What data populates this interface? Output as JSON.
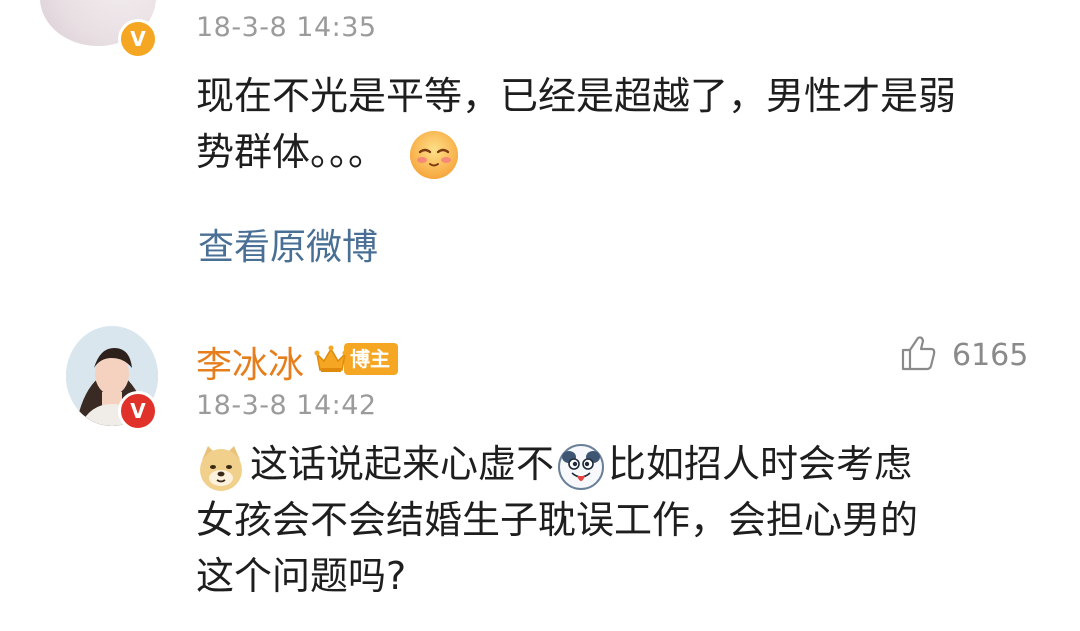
{
  "comments": [
    {
      "timestamp": "18-3-8 14:35",
      "text_part1": "现在不光是平等，已经是超越了，男性才是弱",
      "text_part2": "势群体。。。",
      "emoji_end": "shy-face",
      "verified_badge": "V",
      "view_original_label": "查看原微博"
    },
    {
      "username": "李冰冰",
      "blogger_badge_label": "博主",
      "likes": "6165",
      "timestamp": "18-3-8 14:42",
      "verified_badge": "V",
      "emoji_start": "doge-face",
      "text_part1": "这话说起来心虚不",
      "emoji_mid": "tongue-face",
      "text_part2": "比如招人时会考虑",
      "text_line2": "女孩会不会结婚生子耽误工作，会担心男的",
      "text_line3": "这个问题吗?"
    }
  ],
  "colors": {
    "username": "#e67e1d",
    "link": "#4a6f95",
    "timestamp": "#9b9b9b",
    "badge": "#f5a623"
  }
}
